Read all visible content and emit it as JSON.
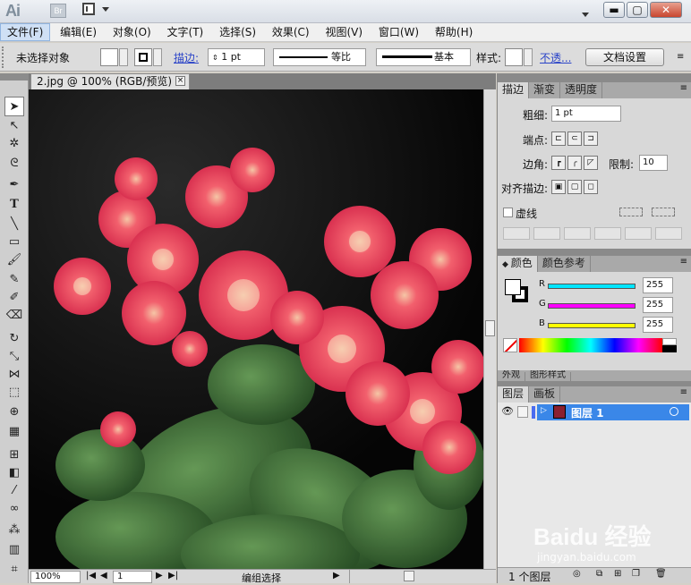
{
  "titlebar": {
    "app_logo": "Ai",
    "bridge": "Br"
  },
  "menu": [
    "文件(F)",
    "编辑(E)",
    "对象(O)",
    "文字(T)",
    "选择(S)",
    "效果(C)",
    "视图(V)",
    "窗口(W)",
    "帮助(H)"
  ],
  "control": {
    "no_selection": "未选择对象",
    "stroke_label": "描边:",
    "stroke_weight": "1 pt",
    "profile_label": "等比",
    "brush_label": "基本",
    "style_label": "样式:",
    "opacity_label": "不透...",
    "doc_setup": "文档设置"
  },
  "document": {
    "tab_title": "2.jpg @ 100% (RGB/预览)",
    "close": "×"
  },
  "status": {
    "zoom": "100%",
    "artboard": "1",
    "tool_status": "编组选择"
  },
  "stroke_panel": {
    "tabs": [
      "描边",
      "渐变",
      "透明度"
    ],
    "weight_label": "粗细:",
    "weight_value": "1 pt",
    "cap_label": "端点:",
    "corner_label": "边角:",
    "limit_label": "限制:",
    "limit_value": "10",
    "align_label": "对齐描边:",
    "dashed_label": "虚线"
  },
  "color_panel": {
    "tabs": [
      "颜色",
      "颜色参考"
    ],
    "channels": [
      {
        "name": "R",
        "value": "255",
        "color": "#00e5ff"
      },
      {
        "name": "G",
        "value": "255",
        "color": "#ff00ff"
      },
      {
        "name": "B",
        "value": "255",
        "color": "#ffff00"
      }
    ]
  },
  "appearance_tabs_partial": [
    "外观",
    "图形样式"
  ],
  "layers_panel": {
    "tabs": [
      "图层",
      "画板"
    ],
    "layer_name": "图层 1",
    "footer_count": "1 个图层"
  },
  "watermark": {
    "brand": "Baidu 经验",
    "url": "jingyan.baidu.com"
  }
}
